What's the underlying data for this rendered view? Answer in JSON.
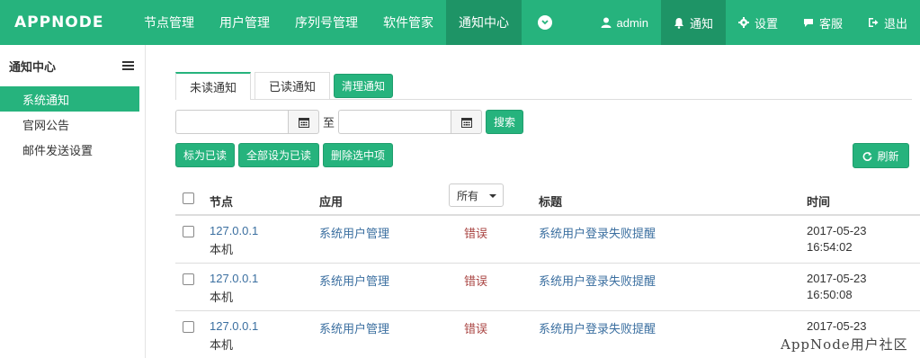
{
  "brand": {
    "logo": "APPNODE"
  },
  "nav": {
    "items": [
      "节点管理",
      "用户管理",
      "序列号管理",
      "软件管家",
      "通知中心"
    ],
    "user": "admin",
    "notify": "通知",
    "settings": "设置",
    "support": "客服",
    "logout": "退出"
  },
  "sidebar": {
    "title": "通知中心",
    "items": [
      "系统通知",
      "官网公告",
      "邮件发送设置"
    ]
  },
  "tabs": {
    "unread": "未读通知",
    "read": "已读通知",
    "clear": "清理通知"
  },
  "filter": {
    "to": "至",
    "search": "搜索",
    "start_value": "",
    "end_value": ""
  },
  "actions": {
    "mark_read": "标为已读",
    "mark_all": "全部设为已读",
    "delete_selected": "删除选中项",
    "refresh": "刷新"
  },
  "table": {
    "headers": {
      "node": "节点",
      "app": "应用",
      "level_filter": "所有",
      "title": "标题",
      "time": "时间"
    },
    "rows": [
      {
        "ip": "127.0.0.1",
        "host": "本机",
        "app": "系统用户管理",
        "level": "错误",
        "title": "系统用户登录失败提醒",
        "date": "2017-05-23",
        "time": "16:54:02"
      },
      {
        "ip": "127.0.0.1",
        "host": "本机",
        "app": "系统用户管理",
        "level": "错误",
        "title": "系统用户登录失败提醒",
        "date": "2017-05-23",
        "time": "16:50:08"
      },
      {
        "ip": "127.0.0.1",
        "host": "本机",
        "app": "系统用户管理",
        "level": "错误",
        "title": "系统用户登录失败提醒",
        "date": "2017-05-23",
        "time": ""
      }
    ]
  },
  "watermark": "AppNode用户社区",
  "colors": {
    "primary": "#26b37d",
    "primary_dark": "#1e9466",
    "link": "#3b6fa0",
    "error": "#a94442"
  }
}
